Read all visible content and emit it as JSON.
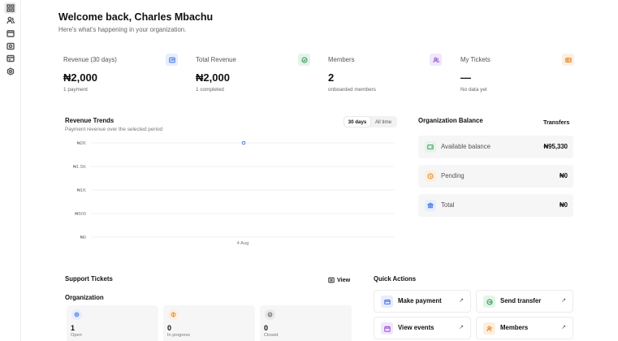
{
  "rail": {
    "items": [
      {
        "icon": "grid-icon",
        "active": true
      },
      {
        "icon": "users-icon",
        "active": false
      },
      {
        "icon": "calendar-icon",
        "active": false
      },
      {
        "icon": "payments-icon",
        "active": false
      },
      {
        "icon": "wallet-icon",
        "active": false
      },
      {
        "icon": "settings-icon",
        "active": false
      }
    ]
  },
  "header": {
    "title": "Welcome back, Charles Mbachu",
    "subtitle": "Here's what's happening in your organization."
  },
  "stats": [
    {
      "label": "Revenue (30 days)",
      "value": "₦2,000",
      "sub": "1 payment",
      "icon": "revenue-icon",
      "color": "#4a78e6",
      "bg": "#e6eefc"
    },
    {
      "label": "Total Revenue",
      "value": "₦2,000",
      "sub": "1 completed",
      "icon": "check-circle-icon",
      "color": "#3e9a5e",
      "bg": "#e4f4ea"
    },
    {
      "label": "Members",
      "value": "2",
      "sub": "onboarded members",
      "icon": "members-icon",
      "color": "#9b5bd6",
      "bg": "#f1e7fb"
    },
    {
      "label": "My Tickets",
      "value": "—",
      "sub": "No data yet",
      "icon": "ticket-icon",
      "color": "#e08a2e",
      "bg": "#fcefdf"
    }
  ],
  "revenue_trends": {
    "title": "Revenue Trends",
    "subtitle": "Payment revenue over the selected period",
    "range_options": [
      "30 days",
      "All time"
    ],
    "range_selected": "30 days"
  },
  "chart_data": {
    "type": "line",
    "x": [
      "4 Aug"
    ],
    "series": [
      {
        "values": [
          2000
        ]
      }
    ],
    "y_ticks": [
      "₦0",
      "₦500",
      "₦1K",
      "₦1.5K",
      "₦2K"
    ],
    "ylim": [
      0,
      2000
    ],
    "grid": true,
    "accent": "#4a78e6"
  },
  "balance": {
    "title": "Organization Balance",
    "link": "Transfers",
    "rows": [
      {
        "label": "Available balance",
        "value": "₦95,330",
        "icon": "wallet-icon",
        "color": "#3e9a5e",
        "bg": "#e4f4ea"
      },
      {
        "label": "Pending",
        "value": "₦0",
        "icon": "clock-icon",
        "color": "#e08a2e",
        "bg": "#fcefdf"
      },
      {
        "label": "Total",
        "value": "₦0",
        "icon": "bank-icon",
        "color": "#4a78e6",
        "bg": "#e6eefc"
      }
    ]
  },
  "support": {
    "title": "Support Tickets",
    "view_label": "View",
    "group_label": "Organization",
    "cards": [
      {
        "count": "1",
        "label": "Open",
        "icon": "open-ticket-icon",
        "color": "#4a78e6",
        "bg": "#e6eefc"
      },
      {
        "count": "0",
        "label": "In progress",
        "icon": "progress-icon",
        "color": "#e08a2e",
        "bg": "#fcefdf"
      },
      {
        "count": "0",
        "label": "Closed",
        "icon": "closed-icon",
        "color": "#666666",
        "bg": "#e8e8e8"
      }
    ]
  },
  "quick_actions": {
    "title": "Quick Actions",
    "arrow": "↗",
    "items": [
      {
        "label": "Make payment",
        "icon": "payment-icon",
        "color": "#4a78e6",
        "bg": "#e6eefc"
      },
      {
        "label": "Send transfer",
        "icon": "transfer-icon",
        "color": "#3e9a5e",
        "bg": "#e4f4ea"
      },
      {
        "label": "View events",
        "icon": "calendar-icon",
        "color": "#9b5bd6",
        "bg": "#f1e7fb"
      },
      {
        "label": "Members",
        "icon": "members-icon",
        "color": "#e08a2e",
        "bg": "#fcefdf"
      }
    ]
  }
}
